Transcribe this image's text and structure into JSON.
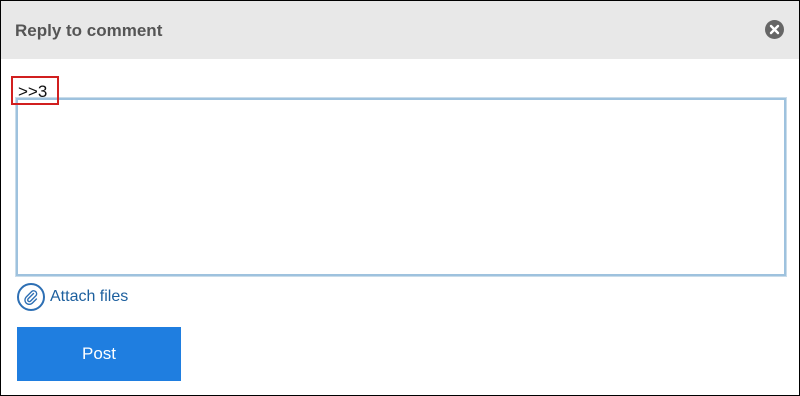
{
  "dialog": {
    "title": "Reply to comment",
    "close_icon": "close-circle-icon"
  },
  "reply": {
    "reference": ">>3",
    "comment_value": ""
  },
  "attach": {
    "icon": "paperclip-icon",
    "label": "Attach files"
  },
  "actions": {
    "post_label": "Post"
  },
  "colors": {
    "header_bg": "#e8e8e8",
    "post_button": "#1f7ee0",
    "link": "#1c5f9e",
    "highlight_box": "#d11f1f"
  }
}
